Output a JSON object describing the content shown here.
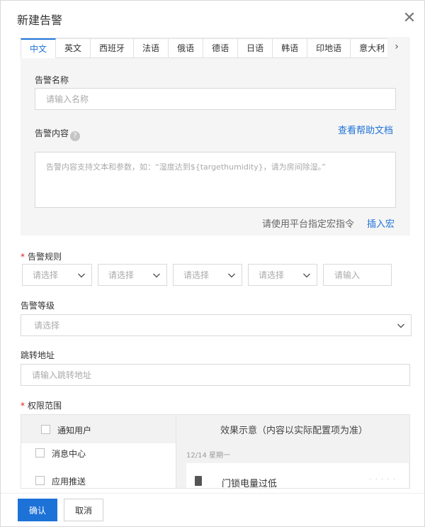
{
  "dialog": {
    "title": "新建告警",
    "close_icon": "close-icon"
  },
  "language_tabs": {
    "items": [
      "中文",
      "英文",
      "西班牙",
      "法语",
      "俄语",
      "德语",
      "日语",
      "韩语",
      "印地语",
      "意大利"
    ],
    "active_index": 0,
    "prev_icon": "chevron-left-icon",
    "next_icon": "chevron-right-icon"
  },
  "alert_name": {
    "label": "告警名称",
    "placeholder": "请输入名称"
  },
  "alert_content": {
    "label": "告警内容",
    "help_icon": "question-circle-icon",
    "help_glyph": "?",
    "help_link": "查看帮助文档",
    "placeholder": "告警内容支持文本和参数，如：“湿度达到${targethumidity}，请为房间除湿。”",
    "macro_hint": "请使用平台指定宏指令",
    "insert_macro_link": "插入宏"
  },
  "alert_rule": {
    "required_mark": "*",
    "label": "告警规则",
    "selects": [
      "请选择",
      "请选择",
      "请选择",
      "请选择"
    ],
    "value_placeholder": "请输入"
  },
  "alert_level": {
    "label": "告警等级",
    "placeholder": "请选择"
  },
  "redirect_url": {
    "label": "跳转地址",
    "placeholder": "请输入跳转地址"
  },
  "permission": {
    "required_mark": "*",
    "label": "权限范围",
    "group_label": "通知用户",
    "options": [
      "消息中心",
      "应用推送"
    ],
    "preview_title": "效果示意（内容以实际配置项为准）",
    "preview_date": "12/14 星期一",
    "preview_message": "门锁电量过低",
    "preview_dots": "· · · · ·"
  },
  "footer": {
    "confirm_label": "确认",
    "cancel_label": "取消"
  },
  "colors": {
    "accent": "#1d72d8",
    "required": "#e02020",
    "panel_bg": "#f5f5f5"
  }
}
